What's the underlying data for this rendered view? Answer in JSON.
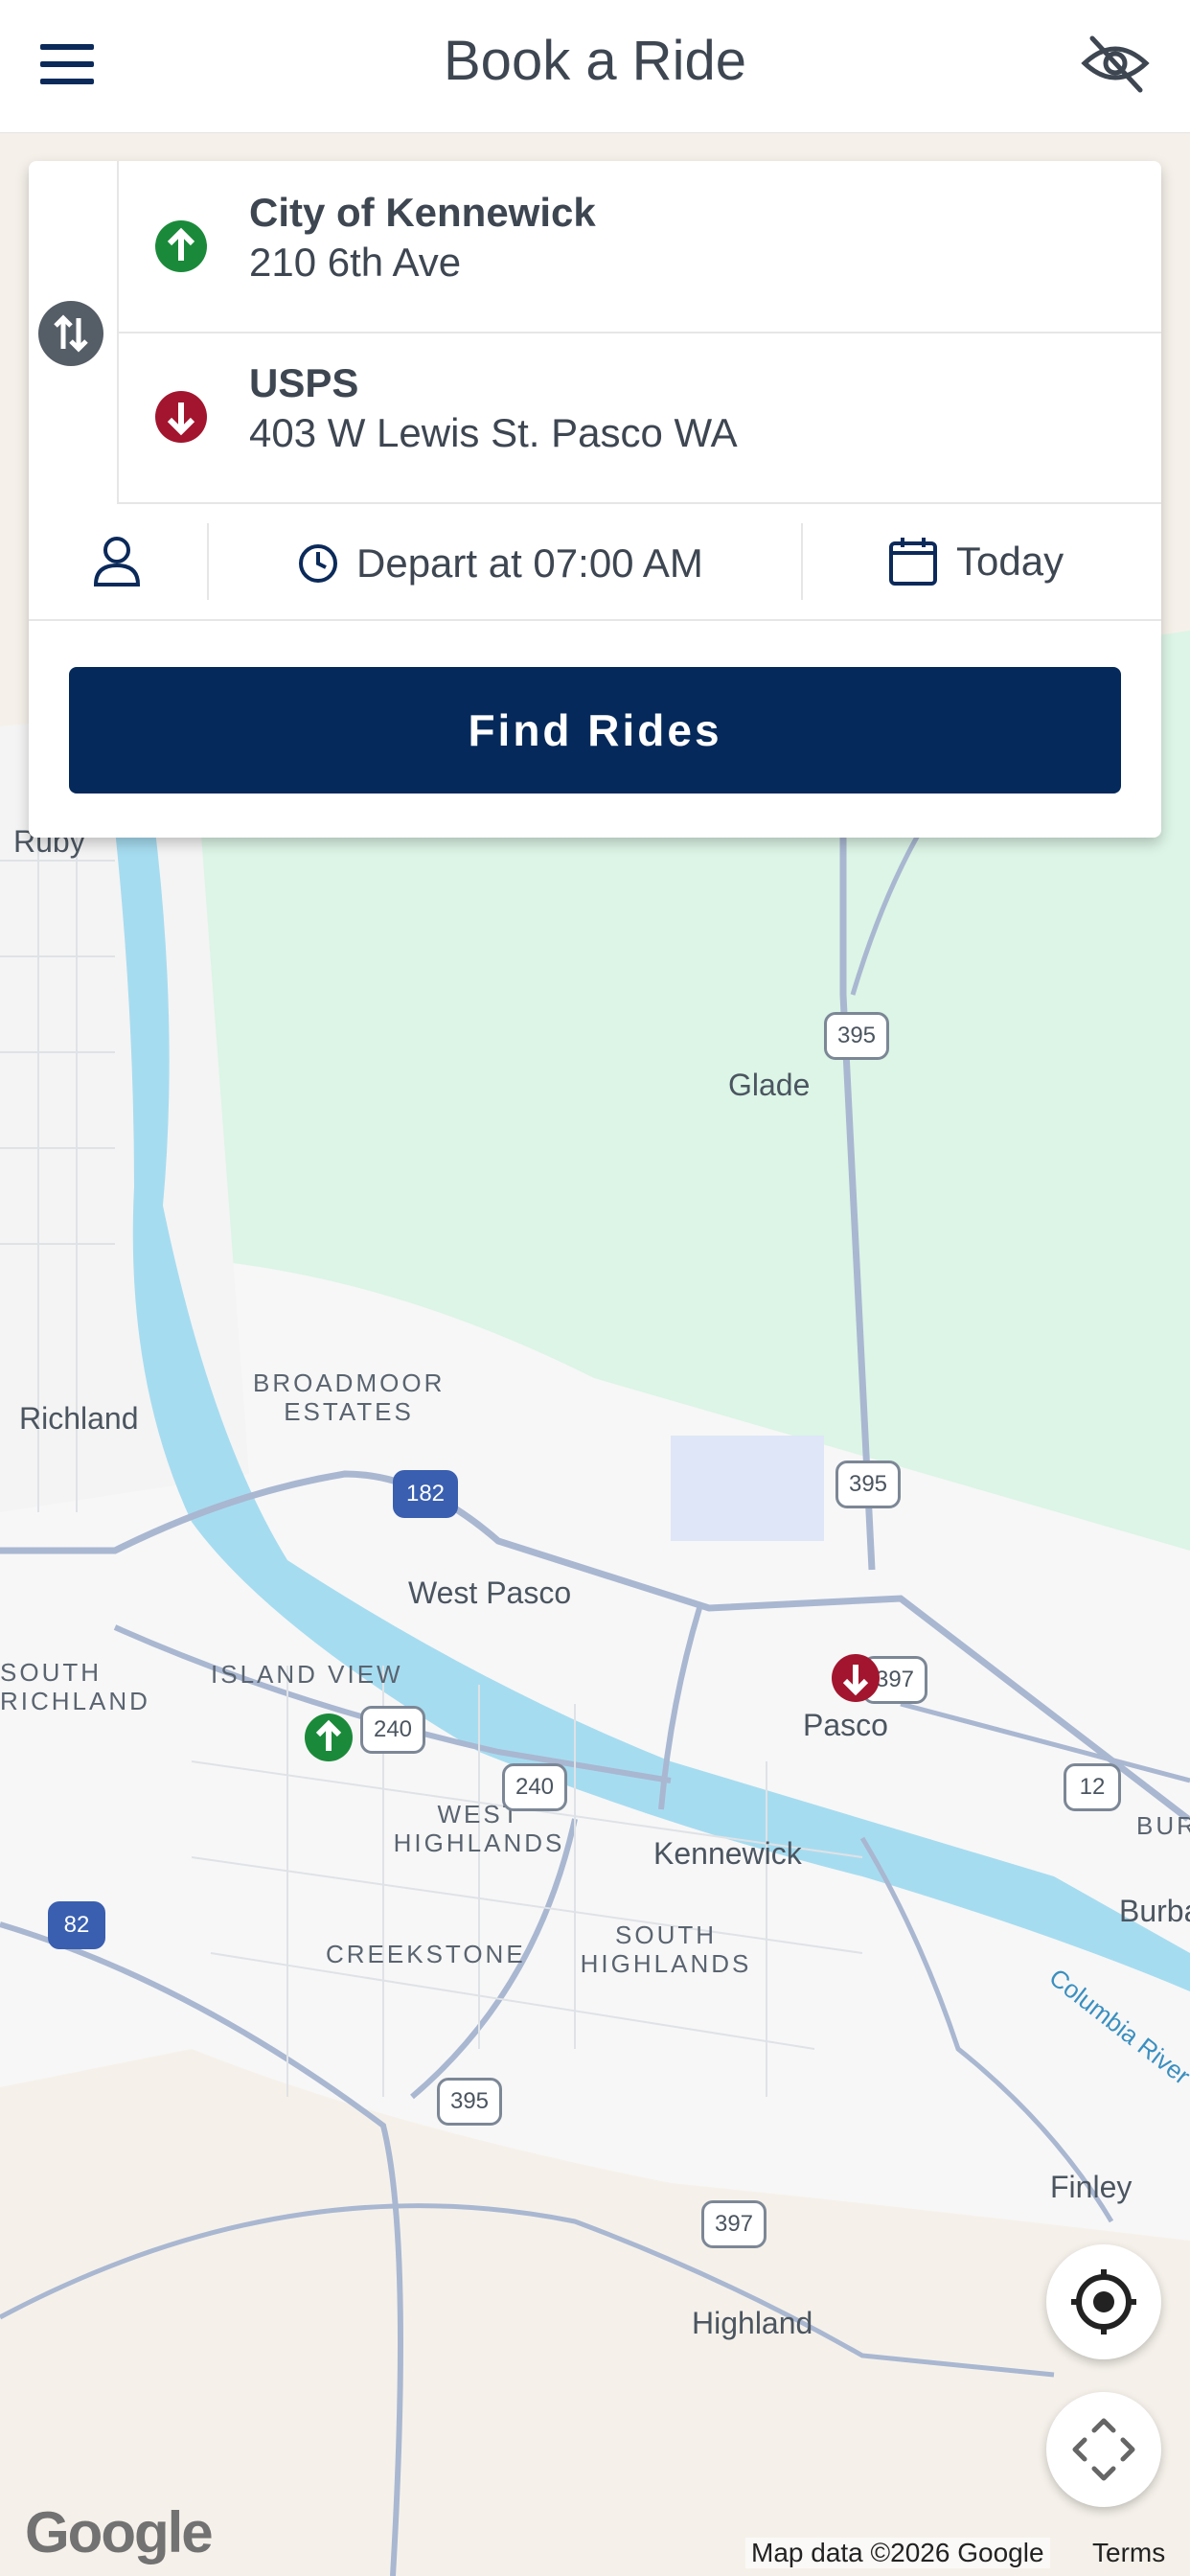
{
  "header": {
    "title": "Book a Ride",
    "menu_icon": "hamburger-menu-icon",
    "visibility_icon": "eye-off-icon"
  },
  "trip": {
    "origin": {
      "name": "City of Kennewick",
      "address": "210 6th Ave",
      "pin_color": "#1a8a3a"
    },
    "destination": {
      "name": "USPS",
      "address": "403 W Lewis St. Pasco WA",
      "pin_color": "#a3152e"
    },
    "depart_label": "Depart at 07:00 AM",
    "date_label": "Today",
    "find_button": "Find Rides"
  },
  "map": {
    "places": [
      "Ruby",
      "Glade",
      "Richland",
      "BROADMOOR ESTATES",
      "West Pasco",
      "SOUTH RICHLAND",
      "ISLAND VIEW",
      "Pasco",
      "WEST HIGHLANDS",
      "Kennewick",
      "SOUTH HIGHLANDS",
      "CREEKSTONE",
      "Finley",
      "Highland",
      "BURBANK HEIGHTS",
      "Burbank",
      "Columbia River"
    ],
    "shields": [
      "395",
      "395",
      "182",
      "240",
      "240",
      "397",
      "12",
      "82",
      "395",
      "397"
    ],
    "attribution": "Map data ©2026 Google",
    "terms": "Terms",
    "logo": "Google"
  }
}
